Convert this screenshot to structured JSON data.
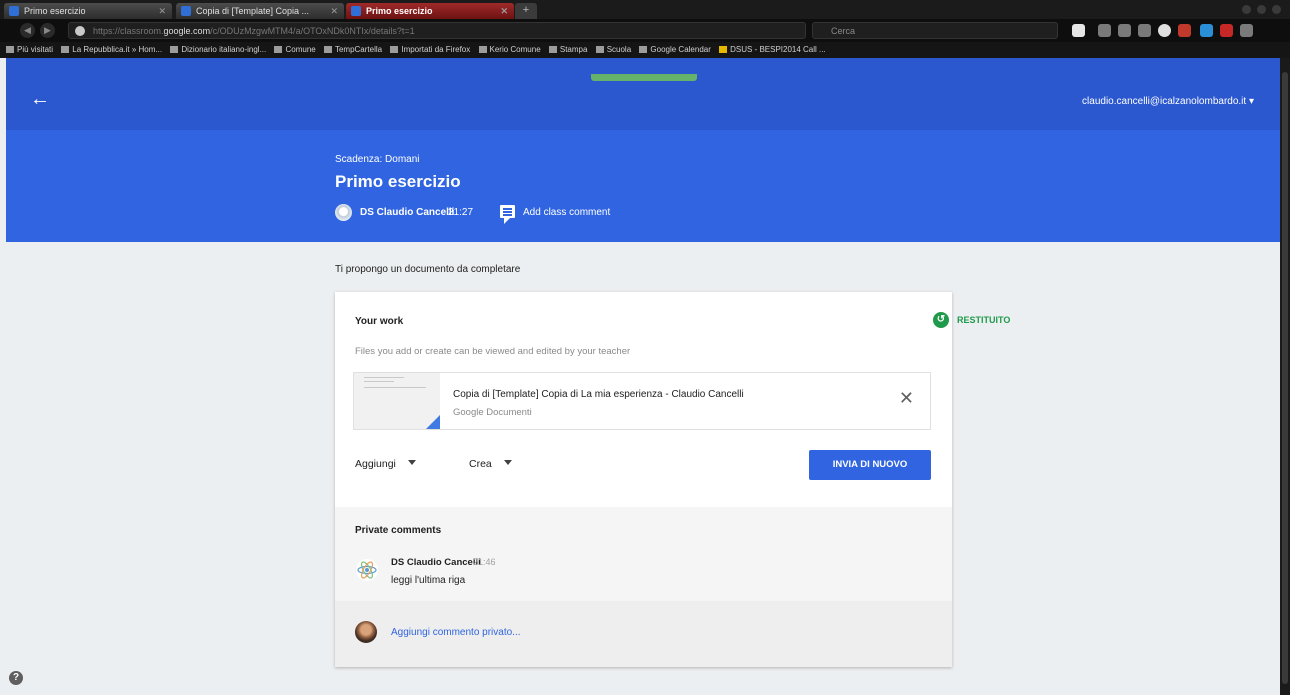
{
  "browser": {
    "tabs": [
      {
        "label": "Primo esercizio"
      },
      {
        "label": "Copia di [Template] Copia ..."
      },
      {
        "label": "Primo esercizio",
        "active": true
      }
    ],
    "url_prefix": "https://classroom.",
    "url_domain": "google.com",
    "url_rest": "/c/ODUzMzgwMTM4/a/OTOxNDk0NTIx/details?t=1",
    "search_placeholder": "Cerca",
    "bookmarks": [
      "Più visitati",
      "La Repubblica.it » Hom...",
      "Dizionario italiano-ingl...",
      "Comune",
      "TempCartella",
      "Importati da Firefox",
      "Kerio Comune",
      "Stampa",
      "Scuola",
      "Google Calendar",
      "DSUS - BESPI2014 Call ..."
    ]
  },
  "appbar": {
    "back_icon": "arrow-back-icon",
    "account": "claudio.cancelli@icalzanolombardo.it"
  },
  "assignment": {
    "deadline": "Scadenza: Domani",
    "title": "Primo esercizio",
    "author": "DS Claudio Cancelli",
    "time": "21:27",
    "add_class_comment": "Add class comment",
    "description": "Ti propongo un documento da completare"
  },
  "work": {
    "heading": "Your work",
    "status": "RESTITUITO",
    "note": "Files you add or create can be viewed and edited by your teacher",
    "attachment": {
      "title": "Copia di [Template] Copia di La mia esperienza - Claudio Cancelli",
      "type": "Google Documenti"
    },
    "add_label": "Aggiungi",
    "create_label": "Crea",
    "resubmit_label": "INVIA DI NUOVO"
  },
  "private_comments": {
    "heading": "Private comments",
    "comments": [
      {
        "author": "DS Claudio Cancelli",
        "time": "21:46",
        "text": "leggi l'ultima riga"
      }
    ],
    "input_placeholder": "Aggiungi commento privato..."
  },
  "colors": {
    "appbar": "#2b57cf",
    "hero": "#3064e1",
    "status_green": "#1f9a4a",
    "background": "#eceff1"
  }
}
